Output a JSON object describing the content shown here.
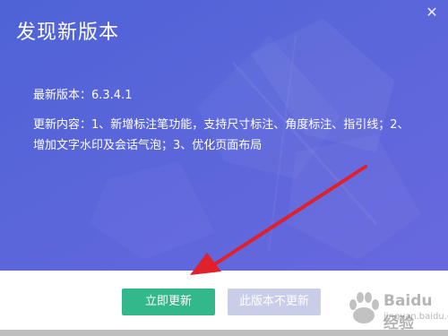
{
  "dialog": {
    "title": "发现新版本",
    "close_icon": "close-icon",
    "version_text": "最新版本：6.3.4.1",
    "content_text": "更新内容：1、新增标注笔功能，支持尺寸标注、角度标注、指引线；2、增加文字水印及会话气泡；3、优化页面布局",
    "buttons": {
      "update_now": "立即更新",
      "skip_version": "此版本不更新"
    }
  },
  "watermark": {
    "brand": "Baidu经验",
    "sub": "jingyan.baidu.com"
  },
  "colors": {
    "banner": "#5563d8",
    "primary_button": "#33b88c",
    "secondary_button": "#c9cde8",
    "arrow": "#e0202a"
  }
}
